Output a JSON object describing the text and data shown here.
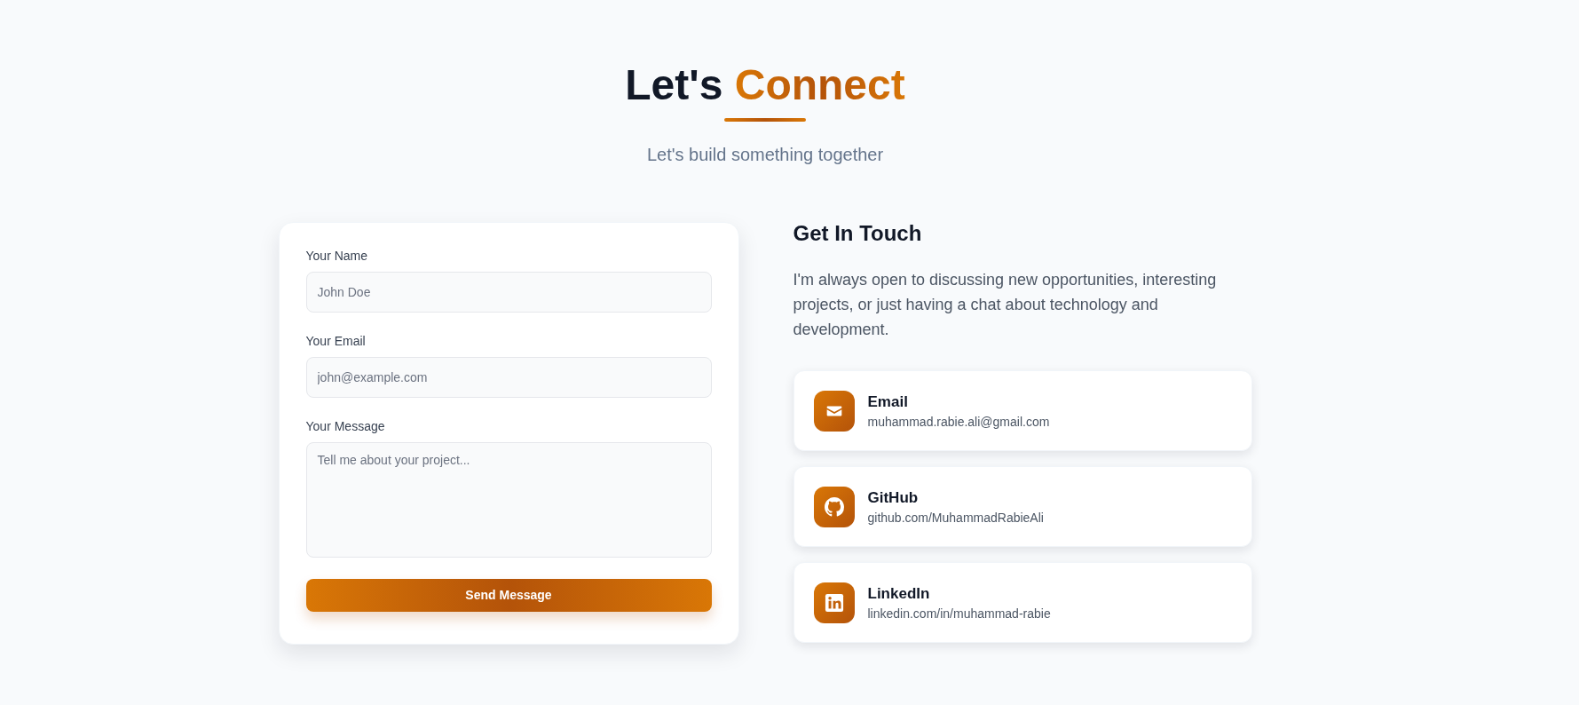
{
  "header": {
    "title_lead": "Let's",
    "title_highlight": "Connect",
    "subtitle": "Let's build something together"
  },
  "form": {
    "fields": [
      {
        "kind": "input",
        "label": "Your Name",
        "placeholder": "John Doe"
      },
      {
        "kind": "input",
        "label": "Your Email",
        "placeholder": "john@example.com"
      },
      {
        "kind": "textarea",
        "label": "Your Message",
        "placeholder": "Tell me about your project..."
      }
    ],
    "submit_button": "Send Message"
  },
  "contact": {
    "title": "Get In Touch",
    "description": "I'm always open to discussing new opportunities, interesting projects, or just having a chat about technology and development.",
    "methods": [
      {
        "kind": "email",
        "label": "Email",
        "value": "muhammad.rabie.ali@gmail.com"
      },
      {
        "kind": "github",
        "label": "GitHub",
        "value": "github.com/MuhammadRabieAli"
      },
      {
        "kind": "linkedin",
        "label": "LinkedIn",
        "value": "linkedin.com/in/muhammad-rabie"
      }
    ]
  }
}
